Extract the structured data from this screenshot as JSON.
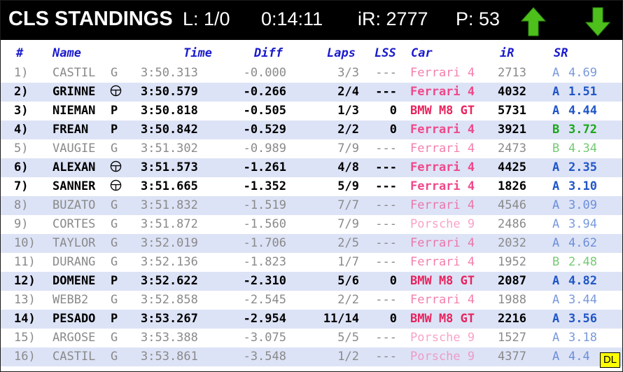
{
  "header": {
    "title": "CLS STANDINGS",
    "lap": "L: 1/0",
    "clock": "0:14:11",
    "ir": "iR: 2777",
    "p": "P: 53",
    "up_icon": "up-arrow-icon",
    "down_icon": "down-arrow-icon"
  },
  "columns": {
    "pos": "#",
    "name": "Name",
    "time": "Time",
    "diff": "Diff",
    "laps": "Laps",
    "lss": "LSS",
    "car": "Car",
    "ir": "iR",
    "sr": "SR"
  },
  "colors": {
    "ferrari": "#f0488a",
    "porsche": "#f77bb1",
    "bmw": "#e8245e",
    "license_a": "#2056c8",
    "license_b": "#18a818",
    "row_alt": "#dde3f6",
    "dim_text": "#8a8a8a",
    "header_blue": "#1a1acc"
  },
  "rows": [
    {
      "pos": "1)",
      "name": "CASTIL",
      "cls": "G",
      "time": "3:50.313",
      "diff": "-0.000",
      "laps": "3/3",
      "lss": "---",
      "car": "Ferrari 4",
      "ir": "2713",
      "lic": "A",
      "sr": "4.69",
      "style": "dim",
      "car_type": "ferrari"
    },
    {
      "pos": "2)",
      "name": "GRINNE",
      "cls": "",
      "icon": "steering-wheel-icon",
      "time": "3:50.579",
      "diff": "-0.266",
      "laps": "2/4",
      "lss": "---",
      "car": "Ferrari 4",
      "ir": "4032",
      "lic": "A",
      "sr": "1.51",
      "style": "bold",
      "car_type": "ferrari"
    },
    {
      "pos": "3)",
      "name": "NIEMAN",
      "cls": "P",
      "time": "3:50.818",
      "diff": "-0.505",
      "laps": "1/3",
      "lss": "0",
      "car": "BMW M8 GT",
      "ir": "5731",
      "lic": "A",
      "sr": "4.44",
      "style": "bold",
      "car_type": "bmw"
    },
    {
      "pos": "4)",
      "name": "FREAN",
      "cls": "P",
      "time": "3:50.842",
      "diff": "-0.529",
      "laps": "2/2",
      "lss": "0",
      "car": "Ferrari 4",
      "ir": "3921",
      "lic": "B",
      "sr": "3.72",
      "style": "bold",
      "car_type": "ferrari"
    },
    {
      "pos": "5)",
      "name": "VAUGIE",
      "cls": "G",
      "time": "3:51.302",
      "diff": "-0.989",
      "laps": "7/9",
      "lss": "---",
      "car": "Ferrari 4",
      "ir": "2473",
      "lic": "B",
      "sr": "4.34",
      "style": "dim",
      "car_type": "ferrari"
    },
    {
      "pos": "6)",
      "name": "ALEXAN",
      "cls": "",
      "icon": "steering-wheel-icon",
      "time": "3:51.573",
      "diff": "-1.261",
      "laps": "4/8",
      "lss": "---",
      "car": "Ferrari 4",
      "ir": "4425",
      "lic": "A",
      "sr": "2.35",
      "style": "bold",
      "car_type": "ferrari"
    },
    {
      "pos": "7)",
      "name": "SANNER",
      "cls": "",
      "icon": "steering-wheel-icon",
      "time": "3:51.665",
      "diff": "-1.352",
      "laps": "5/9",
      "lss": "---",
      "car": "Ferrari 4",
      "ir": "1826",
      "lic": "A",
      "sr": "3.10",
      "style": "bold",
      "car_type": "ferrari"
    },
    {
      "pos": "8)",
      "name": "BUZATO",
      "cls": "G",
      "time": "3:51.832",
      "diff": "-1.519",
      "laps": "7/7",
      "lss": "---",
      "car": "Ferrari 4",
      "ir": "4546",
      "lic": "A",
      "sr": "3.09",
      "style": "dim",
      "car_type": "ferrari"
    },
    {
      "pos": "9)",
      "name": "CORTES",
      "cls": "G",
      "time": "3:51.872",
      "diff": "-1.560",
      "laps": "7/9",
      "lss": "---",
      "car": "Porsche 9",
      "ir": "2486",
      "lic": "A",
      "sr": "3.94",
      "style": "dim",
      "car_type": "porsche"
    },
    {
      "pos": "10)",
      "name": "TAYLOR",
      "cls": "G",
      "time": "3:52.019",
      "diff": "-1.706",
      "laps": "2/5",
      "lss": "---",
      "car": "Ferrari 4",
      "ir": "2032",
      "lic": "A",
      "sr": "4.62",
      "style": "dim",
      "car_type": "ferrari"
    },
    {
      "pos": "11)",
      "name": "DURANG",
      "cls": "G",
      "time": "3:52.136",
      "diff": "-1.823",
      "laps": "1/7",
      "lss": "---",
      "car": "Ferrari 4",
      "ir": "1952",
      "lic": "B",
      "sr": "2.48",
      "style": "dim",
      "car_type": "ferrari"
    },
    {
      "pos": "12)",
      "name": "DOMENE",
      "cls": "P",
      "time": "3:52.622",
      "diff": "-2.310",
      "laps": "5/6",
      "lss": "0",
      "car": "BMW M8 GT",
      "ir": "2087",
      "lic": "A",
      "sr": "4.82",
      "style": "bold",
      "car_type": "bmw"
    },
    {
      "pos": "13)",
      "name": "WEBB2",
      "cls": "G",
      "time": "3:52.858",
      "diff": "-2.545",
      "laps": "2/2",
      "lss": "---",
      "car": "Ferrari 4",
      "ir": "1988",
      "lic": "A",
      "sr": "3.44",
      "style": "dim",
      "car_type": "ferrari"
    },
    {
      "pos": "14)",
      "name": "PESADO",
      "cls": "P",
      "time": "3:53.267",
      "diff": "-2.954",
      "laps": "11/14",
      "lss": "0",
      "car": "BMW M8 GT",
      "ir": "2216",
      "lic": "A",
      "sr": "3.56",
      "style": "bold",
      "car_type": "bmw"
    },
    {
      "pos": "15)",
      "name": "ARGOSE",
      "cls": "G",
      "time": "3:53.388",
      "diff": "-3.075",
      "laps": "5/5",
      "lss": "---",
      "car": "Porsche 9",
      "ir": "1527",
      "lic": "A",
      "sr": "3.18",
      "style": "dim",
      "car_type": "porsche"
    },
    {
      "pos": "16)",
      "name": "CASTIL",
      "cls": "G",
      "time": "3:53.861",
      "diff": "-3.548",
      "laps": "1/2",
      "lss": "---",
      "car": "Porsche 9",
      "ir": "4377",
      "lic": "A",
      "sr": "4.4",
      "style": "dim",
      "car_type": "porsche"
    }
  ],
  "badge": "DL"
}
